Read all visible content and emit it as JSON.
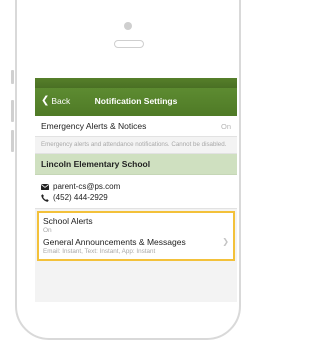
{
  "nav": {
    "back_label": "Back",
    "title": "Notification Settings"
  },
  "emergency": {
    "label": "Emergency Alerts & Notices",
    "value": "On",
    "note": "Emergency alerts and attendance notifications. Cannot be disabled."
  },
  "school": {
    "name": "Lincoln Elementary School",
    "email": "parent-cs@ps.com",
    "phone": "(452) 444-2929"
  },
  "school_alerts": {
    "title": "School Alerts",
    "status": "On",
    "category_title": "General Announcements & Messages",
    "category_detail": "Email: Instant,  Text: Instant,  App: Instant"
  },
  "icons": {
    "back": "chevron-left-icon",
    "email": "envelope-icon",
    "phone": "phone-icon",
    "disclosure": "chevron-right-icon"
  },
  "colors": {
    "navbar": "#5d8b31",
    "school_header": "#cfe0c0",
    "highlight": "#f3c13a"
  }
}
